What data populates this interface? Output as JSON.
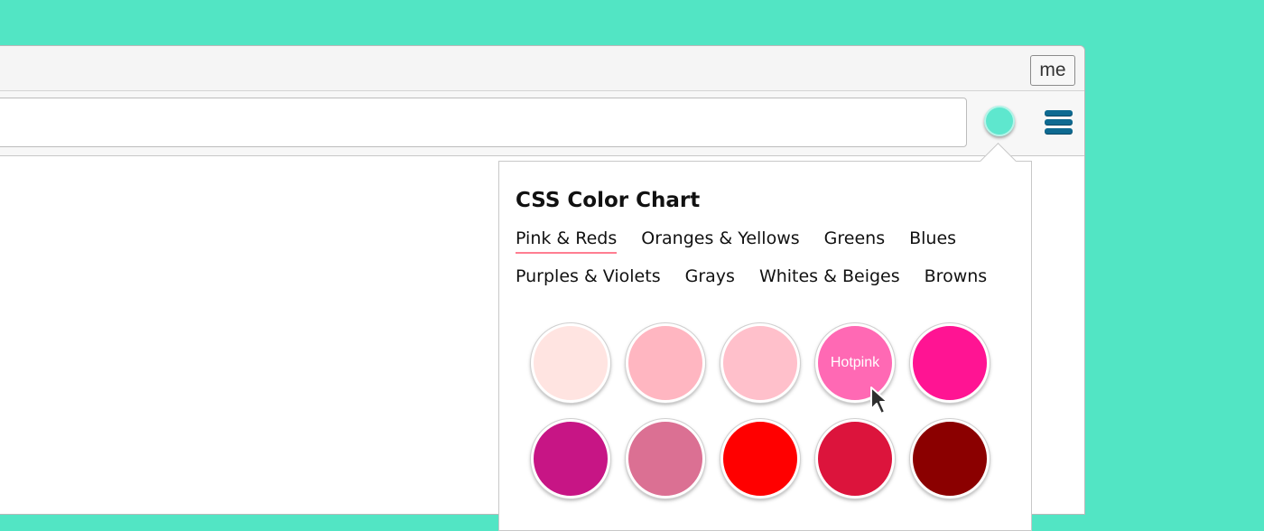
{
  "browser": {
    "profile_label": "me",
    "extension_color": "#5ee7ce",
    "menu_icon": "hamburger-menu-icon"
  },
  "popup": {
    "title": "CSS Color Chart",
    "tabs_row1": [
      "Pink & Reds",
      "Oranges & Yellows",
      "Greens",
      "Blues"
    ],
    "tabs_row2": [
      "Purples & Violets",
      "Grays",
      "Whites & Beiges",
      "Browns"
    ],
    "active_tab": "Pink & Reds",
    "swatches": [
      {
        "color": "#ffe4e1",
        "label": ""
      },
      {
        "color": "#ffb6c1",
        "label": ""
      },
      {
        "color": "#ffc0cb",
        "label": ""
      },
      {
        "color": "#ff69b4",
        "label": "Hotpink"
      },
      {
        "color": "#ff1493",
        "label": ""
      },
      {
        "color": "#c71585",
        "label": ""
      },
      {
        "color": "#db7093",
        "label": ""
      },
      {
        "color": "#ff0000",
        "label": ""
      },
      {
        "color": "#dc143c",
        "label": ""
      },
      {
        "color": "#8b0000",
        "label": ""
      }
    ]
  }
}
